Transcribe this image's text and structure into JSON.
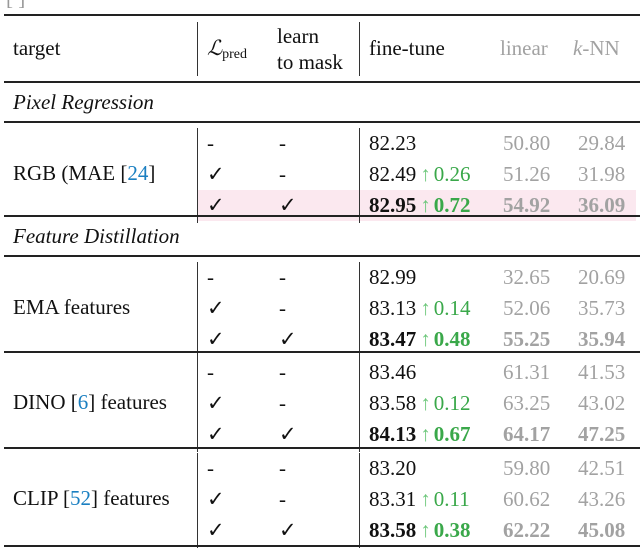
{
  "caption_fragment": "[ ]",
  "header": {
    "target": "target",
    "lpred_symbol": "ℒ",
    "lpred_sub": "pred",
    "learn_line1": "learn",
    "learn_line2": "to mask",
    "finetune": "fine-tune",
    "linear": "linear",
    "knn_k": "k",
    "knn_rest": "-NN"
  },
  "colors": {
    "highlight": "#fbe8ef",
    "gain_green": "#3aa84a",
    "secondary_gray": "#a2a2a2",
    "citation_blue": "#1a7fc1"
  },
  "sections": [
    {
      "title": "Pixel Regression",
      "groups": [
        {
          "target_pre": "RGB (MAE [",
          "cite": "24",
          "target_post": "]",
          "rows": [
            {
              "lpred": "-",
              "learn": "-",
              "ft": "82.23",
              "gain": "",
              "linear": "50.80",
              "knn": "29.84",
              "bold": false,
              "highlight": false
            },
            {
              "lpred": "✓",
              "learn": "-",
              "ft": "82.49",
              "gain": "0.26",
              "linear": "51.26",
              "knn": "31.98",
              "bold": false,
              "highlight": false
            },
            {
              "lpred": "✓",
              "learn": "✓",
              "ft": "82.95",
              "gain": "0.72",
              "linear": "54.92",
              "knn": "36.09",
              "bold": true,
              "highlight": true
            }
          ]
        }
      ]
    },
    {
      "title": "Feature Distillation",
      "groups": [
        {
          "target_pre": "EMA features",
          "cite": "",
          "target_post": "",
          "rows": [
            {
              "lpred": "-",
              "learn": "-",
              "ft": "82.99",
              "gain": "",
              "linear": "32.65",
              "knn": "20.69",
              "bold": false,
              "highlight": false
            },
            {
              "lpred": "✓",
              "learn": "-",
              "ft": "83.13",
              "gain": "0.14",
              "linear": "52.06",
              "knn": "35.73",
              "bold": false,
              "highlight": false
            },
            {
              "lpred": "✓",
              "learn": "✓",
              "ft": "83.47",
              "gain": "0.48",
              "linear": "55.25",
              "knn": "35.94",
              "bold": true,
              "highlight": false
            }
          ]
        },
        {
          "target_pre": "DINO [",
          "cite": "6",
          "target_post": "] features",
          "rows": [
            {
              "lpred": "-",
              "learn": "-",
              "ft": "83.46",
              "gain": "",
              "linear": "61.31",
              "knn": "41.53",
              "bold": false,
              "highlight": false
            },
            {
              "lpred": "✓",
              "learn": "-",
              "ft": "83.58",
              "gain": "0.12",
              "linear": "63.25",
              "knn": "43.02",
              "bold": false,
              "highlight": false
            },
            {
              "lpred": "✓",
              "learn": "✓",
              "ft": "84.13",
              "gain": "0.67",
              "linear": "64.17",
              "knn": "47.25",
              "bold": true,
              "highlight": false
            }
          ]
        },
        {
          "target_pre": "CLIP [",
          "cite": "52",
          "target_post": "] features",
          "rows": [
            {
              "lpred": "-",
              "learn": "-",
              "ft": "83.20",
              "gain": "",
              "linear": "59.80",
              "knn": "42.51",
              "bold": false,
              "highlight": false
            },
            {
              "lpred": "✓",
              "learn": "-",
              "ft": "83.31",
              "gain": "0.11",
              "linear": "60.62",
              "knn": "43.26",
              "bold": false,
              "highlight": false
            },
            {
              "lpred": "✓",
              "learn": "✓",
              "ft": "83.58",
              "gain": "0.38",
              "linear": "62.22",
              "knn": "45.08",
              "bold": true,
              "highlight": false
            }
          ]
        }
      ]
    }
  ],
  "arrow_glyph": "↑"
}
